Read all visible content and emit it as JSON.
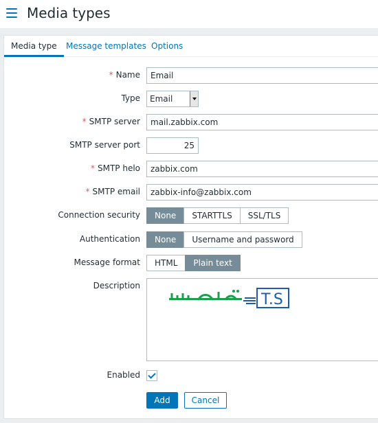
{
  "header": {
    "title": "Media types"
  },
  "tabs": [
    {
      "label": "Media type",
      "active": true
    },
    {
      "label": "Message templates",
      "active": false
    },
    {
      "label": "Options",
      "active": false
    }
  ],
  "form": {
    "name": {
      "label": "Name",
      "required": true,
      "value": "Email"
    },
    "type": {
      "label": "Type",
      "value": "Email"
    },
    "smtp_server": {
      "label": "SMTP server",
      "required": true,
      "value": "mail.zabbix.com"
    },
    "smtp_port": {
      "label": "SMTP server port",
      "value": "25"
    },
    "smtp_helo": {
      "label": "SMTP helo",
      "required": true,
      "value": "zabbix.com"
    },
    "smtp_email": {
      "label": "SMTP email",
      "required": true,
      "value": "zabbix-info@zabbix.com"
    },
    "connection_security": {
      "label": "Connection security",
      "options": [
        "None",
        "STARTTLS",
        "SSL/TLS"
      ],
      "selected": "None"
    },
    "authentication": {
      "label": "Authentication",
      "options": [
        "None",
        "Username and password"
      ],
      "selected": "None"
    },
    "message_format": {
      "label": "Message format",
      "options": [
        "HTML",
        "Plain text"
      ],
      "selected": "Plain text"
    },
    "description": {
      "label": "Description",
      "logo_text": "T.S تهران سرور"
    },
    "enabled": {
      "label": "Enabled",
      "checked": true
    }
  },
  "buttons": {
    "add": "Add",
    "cancel": "Cancel"
  },
  "colors": {
    "accent": "#0275b8",
    "segment_selected": "#768d99",
    "required": "#e45959",
    "logo_green": "#17a14a"
  }
}
